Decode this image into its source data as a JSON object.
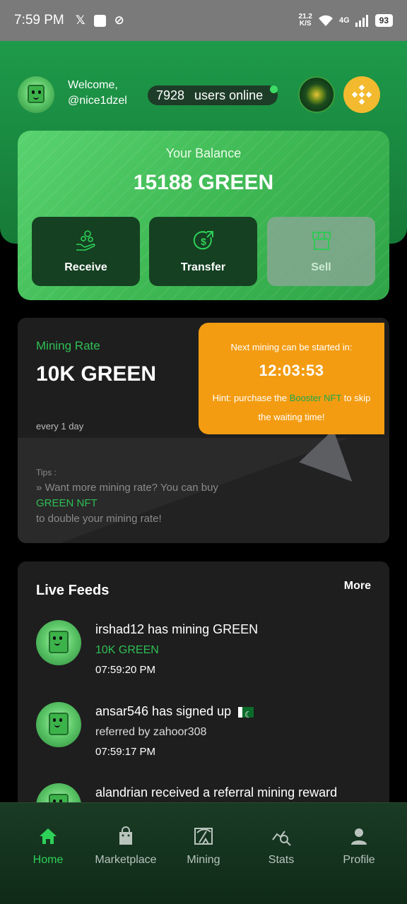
{
  "status_bar": {
    "time": "7:59 PM",
    "speed_top": "21.2",
    "speed_bottom": "K/S",
    "network": "4G",
    "battery": "93"
  },
  "header": {
    "welcome_line1": "Welcome,",
    "welcome_line2": "@nice1dzel",
    "online_count": "7928",
    "online_label": "users online"
  },
  "balance": {
    "title": "Your Balance",
    "value": "15188 GREEN",
    "actions": [
      {
        "label": "Receive",
        "icon": "receive-hand-icon"
      },
      {
        "label": "Transfer",
        "icon": "dollar-transfer-icon"
      },
      {
        "label": "Sell",
        "icon": "store-icon"
      }
    ]
  },
  "mining": {
    "rate_label": "Mining Rate",
    "rate_value": "10K GREEN",
    "period": "every 1 day",
    "tips_heading": "Tips :",
    "tips_line1": "» Want more mining rate? You can buy",
    "tips_link": "GREEN NFT",
    "tips_line2": "to double your mining rate!",
    "next_title": "Next mining can be started in:",
    "timer": "12:03:53",
    "hint_prefix": "Hint: purchase the ",
    "hint_link": "Booster NFT",
    "hint_suffix": " to skip the waiting time!"
  },
  "feeds": {
    "title": "Live Feeds",
    "more": "More",
    "items": [
      {
        "main": "irshad12 has mining GREEN",
        "sub": "10K GREEN",
        "time": "07:59:20 PM"
      },
      {
        "main": "ansar546 has signed up",
        "sub": "referred by zahoor308",
        "time": "07:59:17 PM"
      },
      {
        "main": "alandrian received a referral mining reward",
        "sub": "",
        "time": ""
      }
    ]
  },
  "nav": {
    "items": [
      {
        "label": "Home",
        "icon": "home-icon",
        "active": true
      },
      {
        "label": "Marketplace",
        "icon": "shopping-bag-icon"
      },
      {
        "label": "Mining",
        "icon": "pickaxe-icon"
      },
      {
        "label": "Stats",
        "icon": "stats-search-icon"
      },
      {
        "label": "Profile",
        "icon": "person-icon"
      }
    ]
  },
  "colors": {
    "brand_green": "#1e9a4a",
    "accent_green": "#2fbf55",
    "warning_orange": "#f39c12",
    "binance_yellow": "#f3ba2f"
  }
}
